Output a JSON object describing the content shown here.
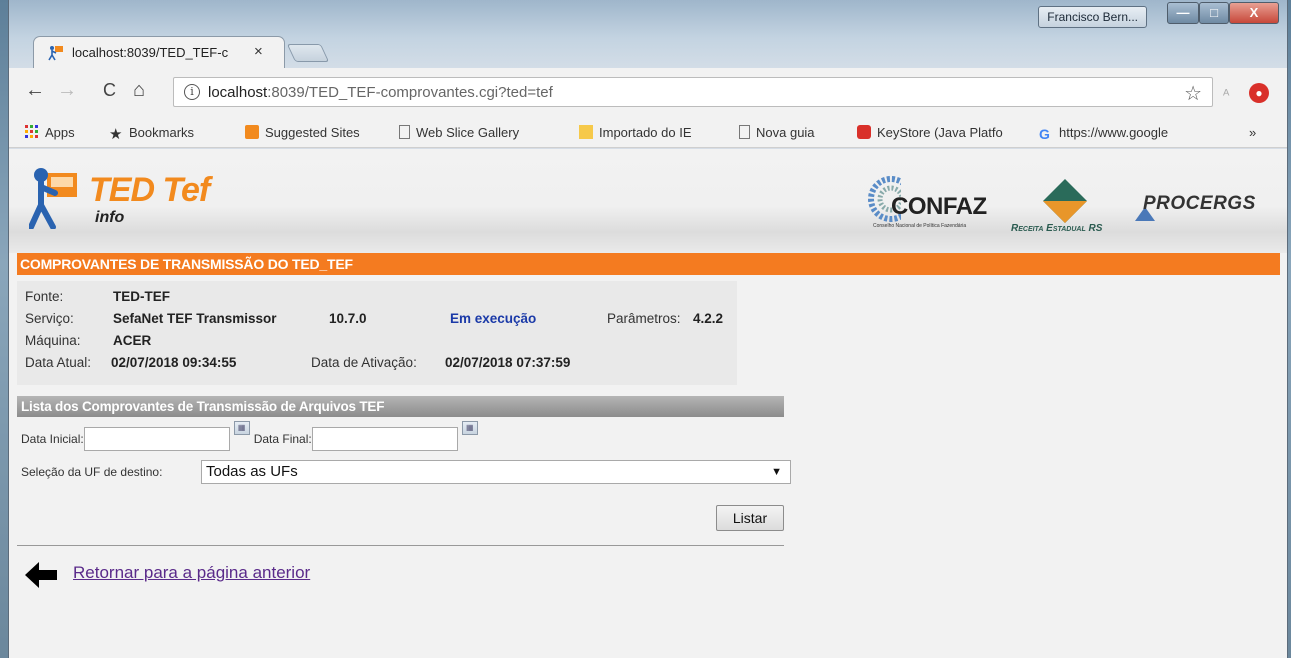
{
  "window": {
    "profile_name": "Francisco Bern...",
    "min_label": "—",
    "max_label": "□",
    "close_label": "X"
  },
  "tab": {
    "title": "localhost:8039/TED_TEF-c",
    "close_label": "×"
  },
  "toolbar": {
    "back_icon": "←",
    "forward_icon": "→",
    "reload_icon": "C",
    "home_icon": "⌂",
    "url_host": "localhost",
    "url_path": ":8039/TED_TEF-comprovantes.cgi?ted=tef",
    "star_icon": "☆"
  },
  "bookmarks": {
    "apps": "Apps",
    "bookmarks": "Bookmarks",
    "suggested": "Suggested Sites",
    "webslice": "Web Slice Gallery",
    "importado": "Importado do IE",
    "novaguia": "Nova guia",
    "keystore": "KeyStore (Java Platfo",
    "google": "https://www.google",
    "overflow": "»"
  },
  "brand": {
    "ted_title": "TED Tef",
    "ted_sub": "info",
    "confaz": "CONFAZ",
    "confaz_tag": "Conselho Nacional de Política Fazendária",
    "receita": "Receita Estadual RS",
    "procergs": "PROCERGS"
  },
  "header": {
    "title": "COMPROVANTES DE TRANSMISSÃO DO TED_TEF"
  },
  "info": {
    "fonte_label": "Fonte:",
    "fonte_value": "TED-TEF",
    "servico_label": "Serviço:",
    "servico_value": "SefaNet TEF Transmissor",
    "servico_version": "10.7.0",
    "servico_status": "Em execução",
    "parametros_label": "Parâmetros:",
    "parametros_value": "4.2.2",
    "maquina_label": "Máquina:",
    "maquina_value": "ACER",
    "data_atual_label": "Data Atual:",
    "data_atual_value": "02/07/2018 09:34:55",
    "data_ativacao_label": "Data de Ativação:",
    "data_ativacao_value": "02/07/2018 07:37:59"
  },
  "list": {
    "title": "Lista dos Comprovantes de Transmissão de Arquivos TEF",
    "data_inicial_label": "Data Inicial:",
    "data_final_label": "Data Final:",
    "uf_label": "Seleção da UF de destino:",
    "uf_selected": "Todas as UFs",
    "listar_label": "Listar"
  },
  "footer": {
    "back_link": "Retornar para a página anterior"
  }
}
